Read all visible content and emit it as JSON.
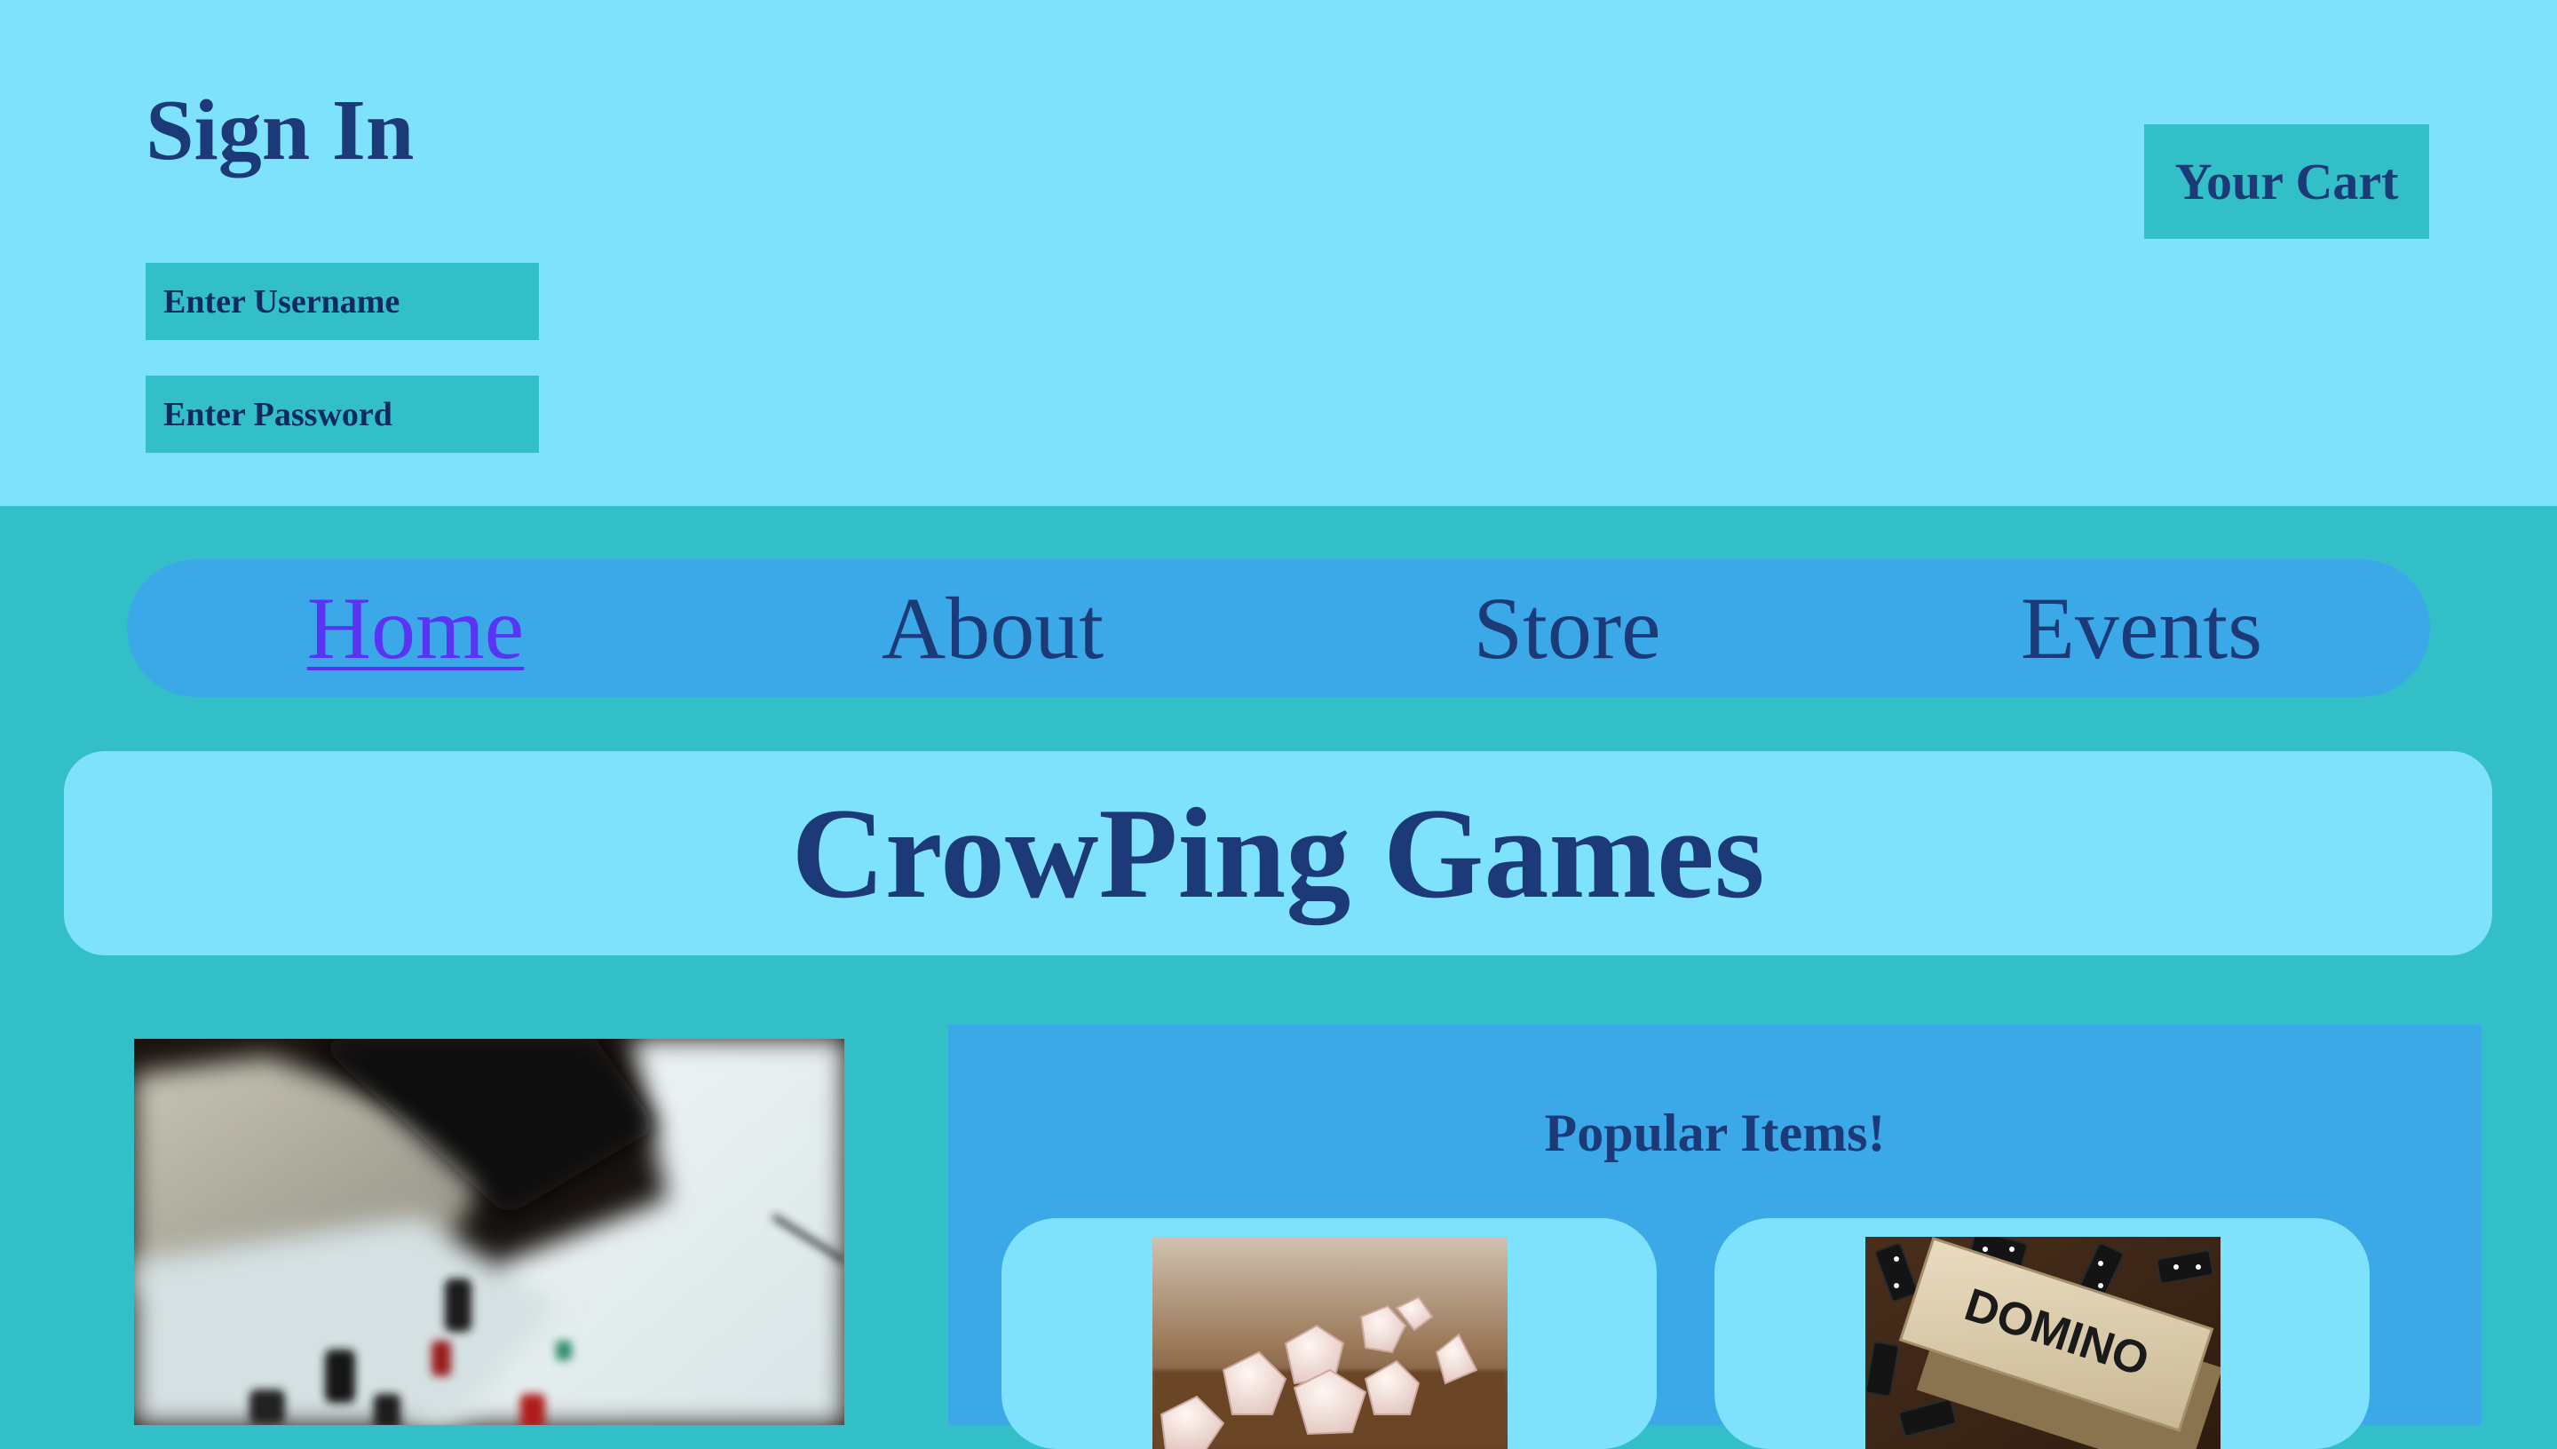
{
  "signin": {
    "title": "Sign In",
    "username_placeholder": "Enter Username",
    "password_placeholder": "Enter Password"
  },
  "cart": {
    "label": "Your Cart"
  },
  "nav": {
    "items": [
      {
        "label": "Home",
        "active": true
      },
      {
        "label": "About",
        "active": false
      },
      {
        "label": "Store",
        "active": false
      },
      {
        "label": "Events",
        "active": false
      }
    ]
  },
  "banner": {
    "title": "CrowPing Games"
  },
  "feature": {
    "image_icon": "board-game-photo-icon"
  },
  "popular": {
    "title": "Popular Items!",
    "items": [
      {
        "image_icon": "polyhedral-dice-photo-icon",
        "box_text": ""
      },
      {
        "image_icon": "domino-box-photo-icon",
        "box_text": "DOMINO"
      }
    ]
  },
  "colors": {
    "header_bg": "#7fe2fc",
    "page_bg": "#33bfc8",
    "nav_bg": "#3ba8e8",
    "text": "#1d3a78",
    "active_link": "#5a33f5"
  }
}
